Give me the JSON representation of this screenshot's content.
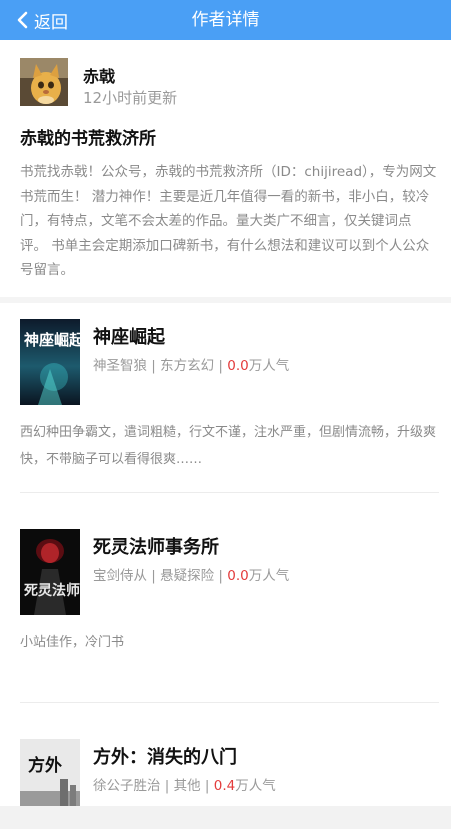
{
  "header": {
    "back_label": "返回",
    "title": "作者详情",
    "bar_color": "#4a9ff5"
  },
  "author": {
    "name": "赤戟",
    "updated": "12小时前更新",
    "shelf_title": "赤戟的书荒救济所",
    "description": "书荒找赤戟！公众号，赤戟的书荒救济所（ID：chijiread），专为网文书荒而生！ 潜力神作！主要是近几年值得一看的新书，非小白，较冷门，有特点，文笔不会太差的作品。量大类广不细言，仅关键词点评。 书单主会定期添加口碑新书，有什么想法和建议可以到个人公众号留言。"
  },
  "books": [
    {
      "title": "神座崛起",
      "author": "神圣智狼",
      "category": "东方玄幻",
      "popularity": "0.0",
      "popularity_unit": "万人气",
      "desc": "西幻种田争霸文，遣词粗糙，行文不谨，注水严重，但剧情流畅，升级爽快，不带脑子可以看得很爽……",
      "cover_text": "神座崛起"
    },
    {
      "title": "死灵法师事务所",
      "author": "宝剑侍从",
      "category": "悬疑探险",
      "popularity": "0.0",
      "popularity_unit": "万人气",
      "desc": "小站佳作，冷门书",
      "cover_text": "死灵法师"
    },
    {
      "title": "方外：消失的八门",
      "author": "徐公子胜治",
      "category": "其他",
      "popularity": "0.4",
      "popularity_unit": "万人气",
      "desc": "",
      "cover_text": "方外"
    }
  ],
  "separator": " | ",
  "accent_colors": {
    "popularity": "#e33b3b",
    "meta": "#9a9a9a"
  }
}
